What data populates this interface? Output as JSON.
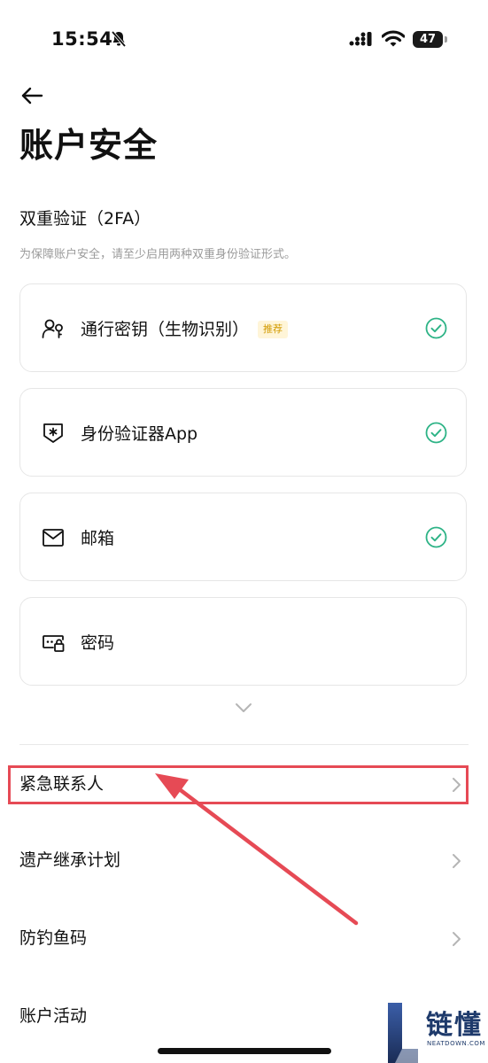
{
  "status_bar": {
    "time": "15:54",
    "battery": "47"
  },
  "header": {
    "title": "账户安全"
  },
  "two_fa": {
    "title": "双重验证（2FA）",
    "description": "为保障账户安全，请至少启用两种双重身份验证形式。",
    "methods": [
      {
        "label": "通行密钥（生物识别）",
        "badge": "推荐",
        "enabled": true,
        "icon": "passkey-user-icon"
      },
      {
        "label": "身份验证器App",
        "enabled": true,
        "icon": "shield-authenticator-icon"
      },
      {
        "label": "邮箱",
        "enabled": true,
        "icon": "mail-icon"
      },
      {
        "label": "密码",
        "enabled": false,
        "icon": "password-lock-icon"
      }
    ]
  },
  "menu": [
    {
      "label": "紧急联系人",
      "highlighted": true
    },
    {
      "label": "遗产继承计划"
    },
    {
      "label": "防钓鱼码"
    },
    {
      "label": "账户活动"
    }
  ],
  "watermark": {
    "main": "链懂",
    "sub": "NEATDOWN.COM",
    "logo": "L"
  },
  "colors": {
    "check": "#2db386",
    "highlight": "#e64a55",
    "badge_text": "#d29a00"
  }
}
